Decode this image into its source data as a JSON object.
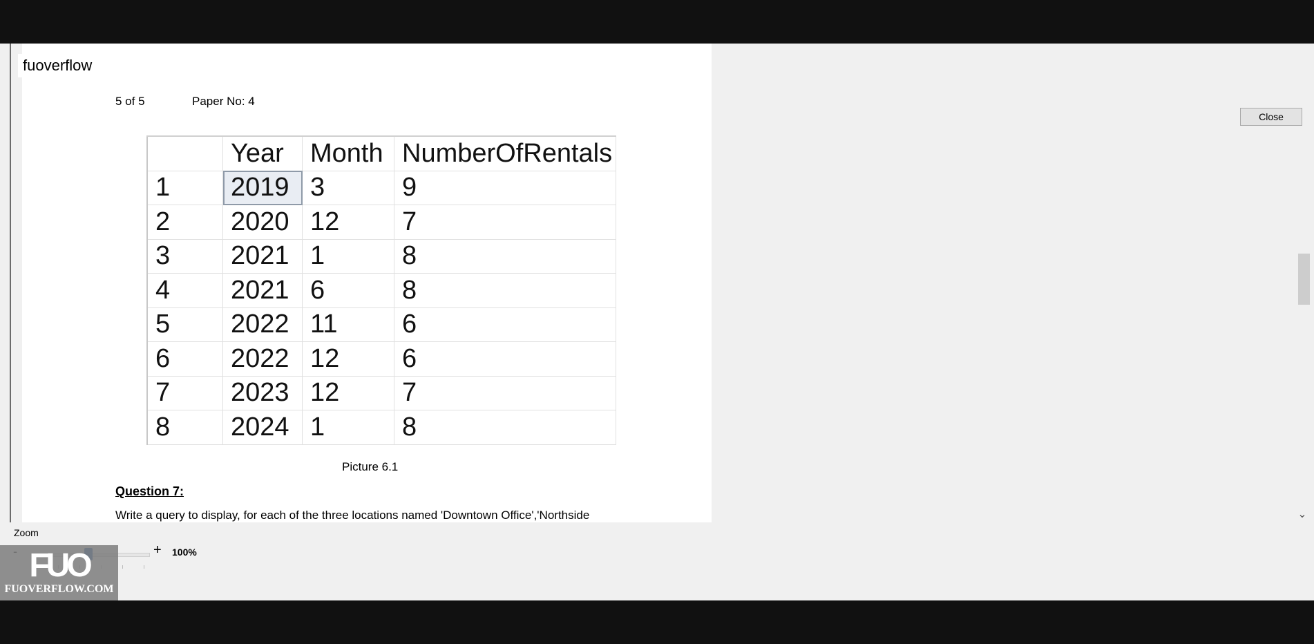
{
  "app_label": "fuoverflow",
  "document": {
    "page_indicator": "5 of 5",
    "paper_no": "Paper No: 4",
    "table": {
      "columns": [
        "",
        "Year",
        "Month",
        "NumberOfRentals"
      ],
      "rows": [
        [
          "1",
          "2019",
          "3",
          "9"
        ],
        [
          "2",
          "2020",
          "12",
          "7"
        ],
        [
          "3",
          "2021",
          "1",
          "8"
        ],
        [
          "4",
          "2021",
          "6",
          "8"
        ],
        [
          "5",
          "2022",
          "11",
          "6"
        ],
        [
          "6",
          "2022",
          "12",
          "6"
        ],
        [
          "7",
          "2023",
          "12",
          "7"
        ],
        [
          "8",
          "2024",
          "1",
          "8"
        ]
      ]
    },
    "caption": "Picture 6.1",
    "question_title": "Question 7:",
    "question_text": "Write a query to display, for each of the three locations named 'Downtown Office','Northside"
  },
  "zoom": {
    "label": "Zoom",
    "minus": "-",
    "plus": "+",
    "value": "100%"
  },
  "close_label": "Close",
  "watermark": {
    "mark": "FUO",
    "text": "FUOVERFLOW.COM"
  },
  "icons": {
    "scroll_down": "chevron-down-icon"
  }
}
